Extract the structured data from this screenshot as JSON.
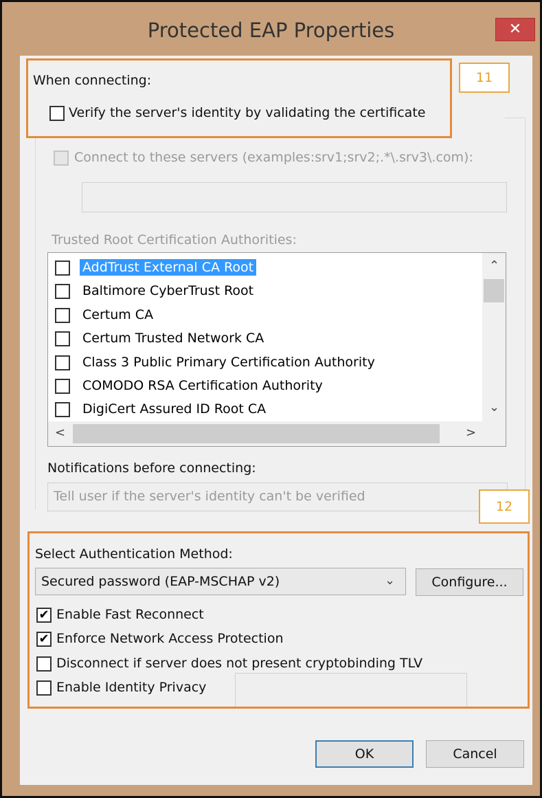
{
  "window": {
    "title": "Protected EAP Properties",
    "close_label": "✕"
  },
  "when_connecting": {
    "heading": "When connecting:",
    "verify_label": "Verify the server's identity by validating the certificate",
    "connect_label": "Connect to these servers (examples:srv1;srv2;.*\\.srv3\\.com):"
  },
  "trusted_root": {
    "heading": "Trusted Root Certification Authorities:",
    "items": [
      {
        "label": "AddTrust External CA Root",
        "selected": true
      },
      {
        "label": "Baltimore CyberTrust Root",
        "selected": false
      },
      {
        "label": "Certum CA",
        "selected": false
      },
      {
        "label": "Certum Trusted Network CA",
        "selected": false
      },
      {
        "label": "Class 3 Public Primary Certification Authority",
        "selected": false
      },
      {
        "label": "COMODO RSA Certification Authority",
        "selected": false
      },
      {
        "label": "DigiCert Assured ID Root CA",
        "selected": false
      }
    ]
  },
  "notifications": {
    "heading": "Notifications before connecting:",
    "value": "Tell user if the server's identity can't be verified"
  },
  "auth": {
    "heading": "Select Authentication Method:",
    "method": "Secured password (EAP-MSCHAP v2)",
    "configure_label": "Configure...",
    "options": [
      {
        "label": "Enable Fast Reconnect",
        "checked": true
      },
      {
        "label": "Enforce Network Access Protection",
        "checked": true
      },
      {
        "label": "Disconnect if server does not present cryptobinding TLV",
        "checked": false
      },
      {
        "label": "Enable Identity Privacy",
        "checked": false
      }
    ]
  },
  "annotations": {
    "tag_11": "11",
    "tag_12": "12"
  },
  "buttons": {
    "ok": "OK",
    "cancel": "Cancel"
  },
  "colors": {
    "title_bar": "#c8a17c",
    "close_button": "#c94747",
    "annotation_border": "#e58a3a",
    "selection": "#3399ff"
  }
}
